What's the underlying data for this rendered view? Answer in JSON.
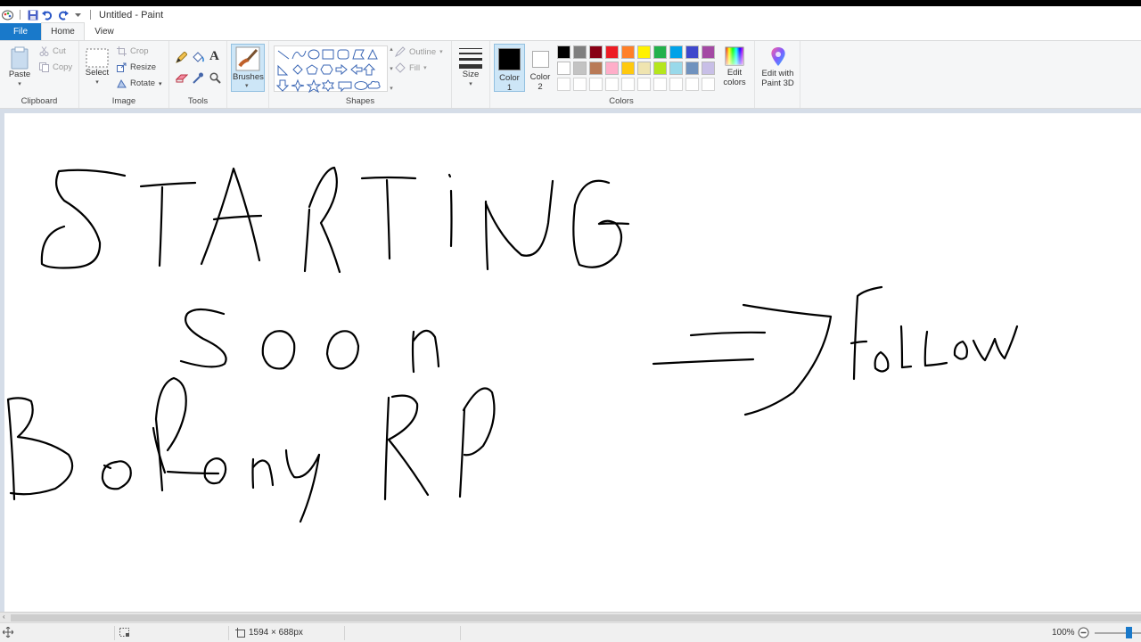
{
  "window": {
    "title": "Untitled - Paint"
  },
  "tabs": [
    {
      "label": "File"
    },
    {
      "label": "Home"
    },
    {
      "label": "View"
    }
  ],
  "clipboard": {
    "paste": "Paste",
    "cut": "Cut",
    "copy": "Copy",
    "label": "Clipboard"
  },
  "image": {
    "select": "Select",
    "crop": "Crop",
    "resize": "Resize",
    "rotate": "Rotate",
    "label": "Image"
  },
  "tools": {
    "label": "Tools",
    "text_glyph": "A"
  },
  "brushes": {
    "label": "Brushes"
  },
  "shapes": {
    "outline": "Outline",
    "fill": "Fill",
    "label": "Shapes"
  },
  "size": {
    "label": "Size"
  },
  "color1": {
    "label": "Color",
    "num": "1",
    "value": "#000000"
  },
  "color2": {
    "label": "Color",
    "num": "2",
    "value": "#ffffff"
  },
  "colors": {
    "label": "Colors",
    "row1": [
      "#000000",
      "#7f7f7f",
      "#880015",
      "#ed1c24",
      "#ff7f27",
      "#fff200",
      "#22b14c",
      "#00a2e8",
      "#3f48cc",
      "#a349a4"
    ],
    "row2": [
      "#ffffff",
      "#c3c3c3",
      "#b97a57",
      "#ffaec9",
      "#ffc90e",
      "#efe4b0",
      "#b5e61d",
      "#99d9ea",
      "#7092be",
      "#c8bfe7"
    ]
  },
  "edit_colors": {
    "line1": "Edit",
    "line2": "colors"
  },
  "paint3d": {
    "line1": "Edit with",
    "line2": "Paint 3D"
  },
  "status": {
    "image_size": "1594 × 688px",
    "zoom": "100%"
  }
}
